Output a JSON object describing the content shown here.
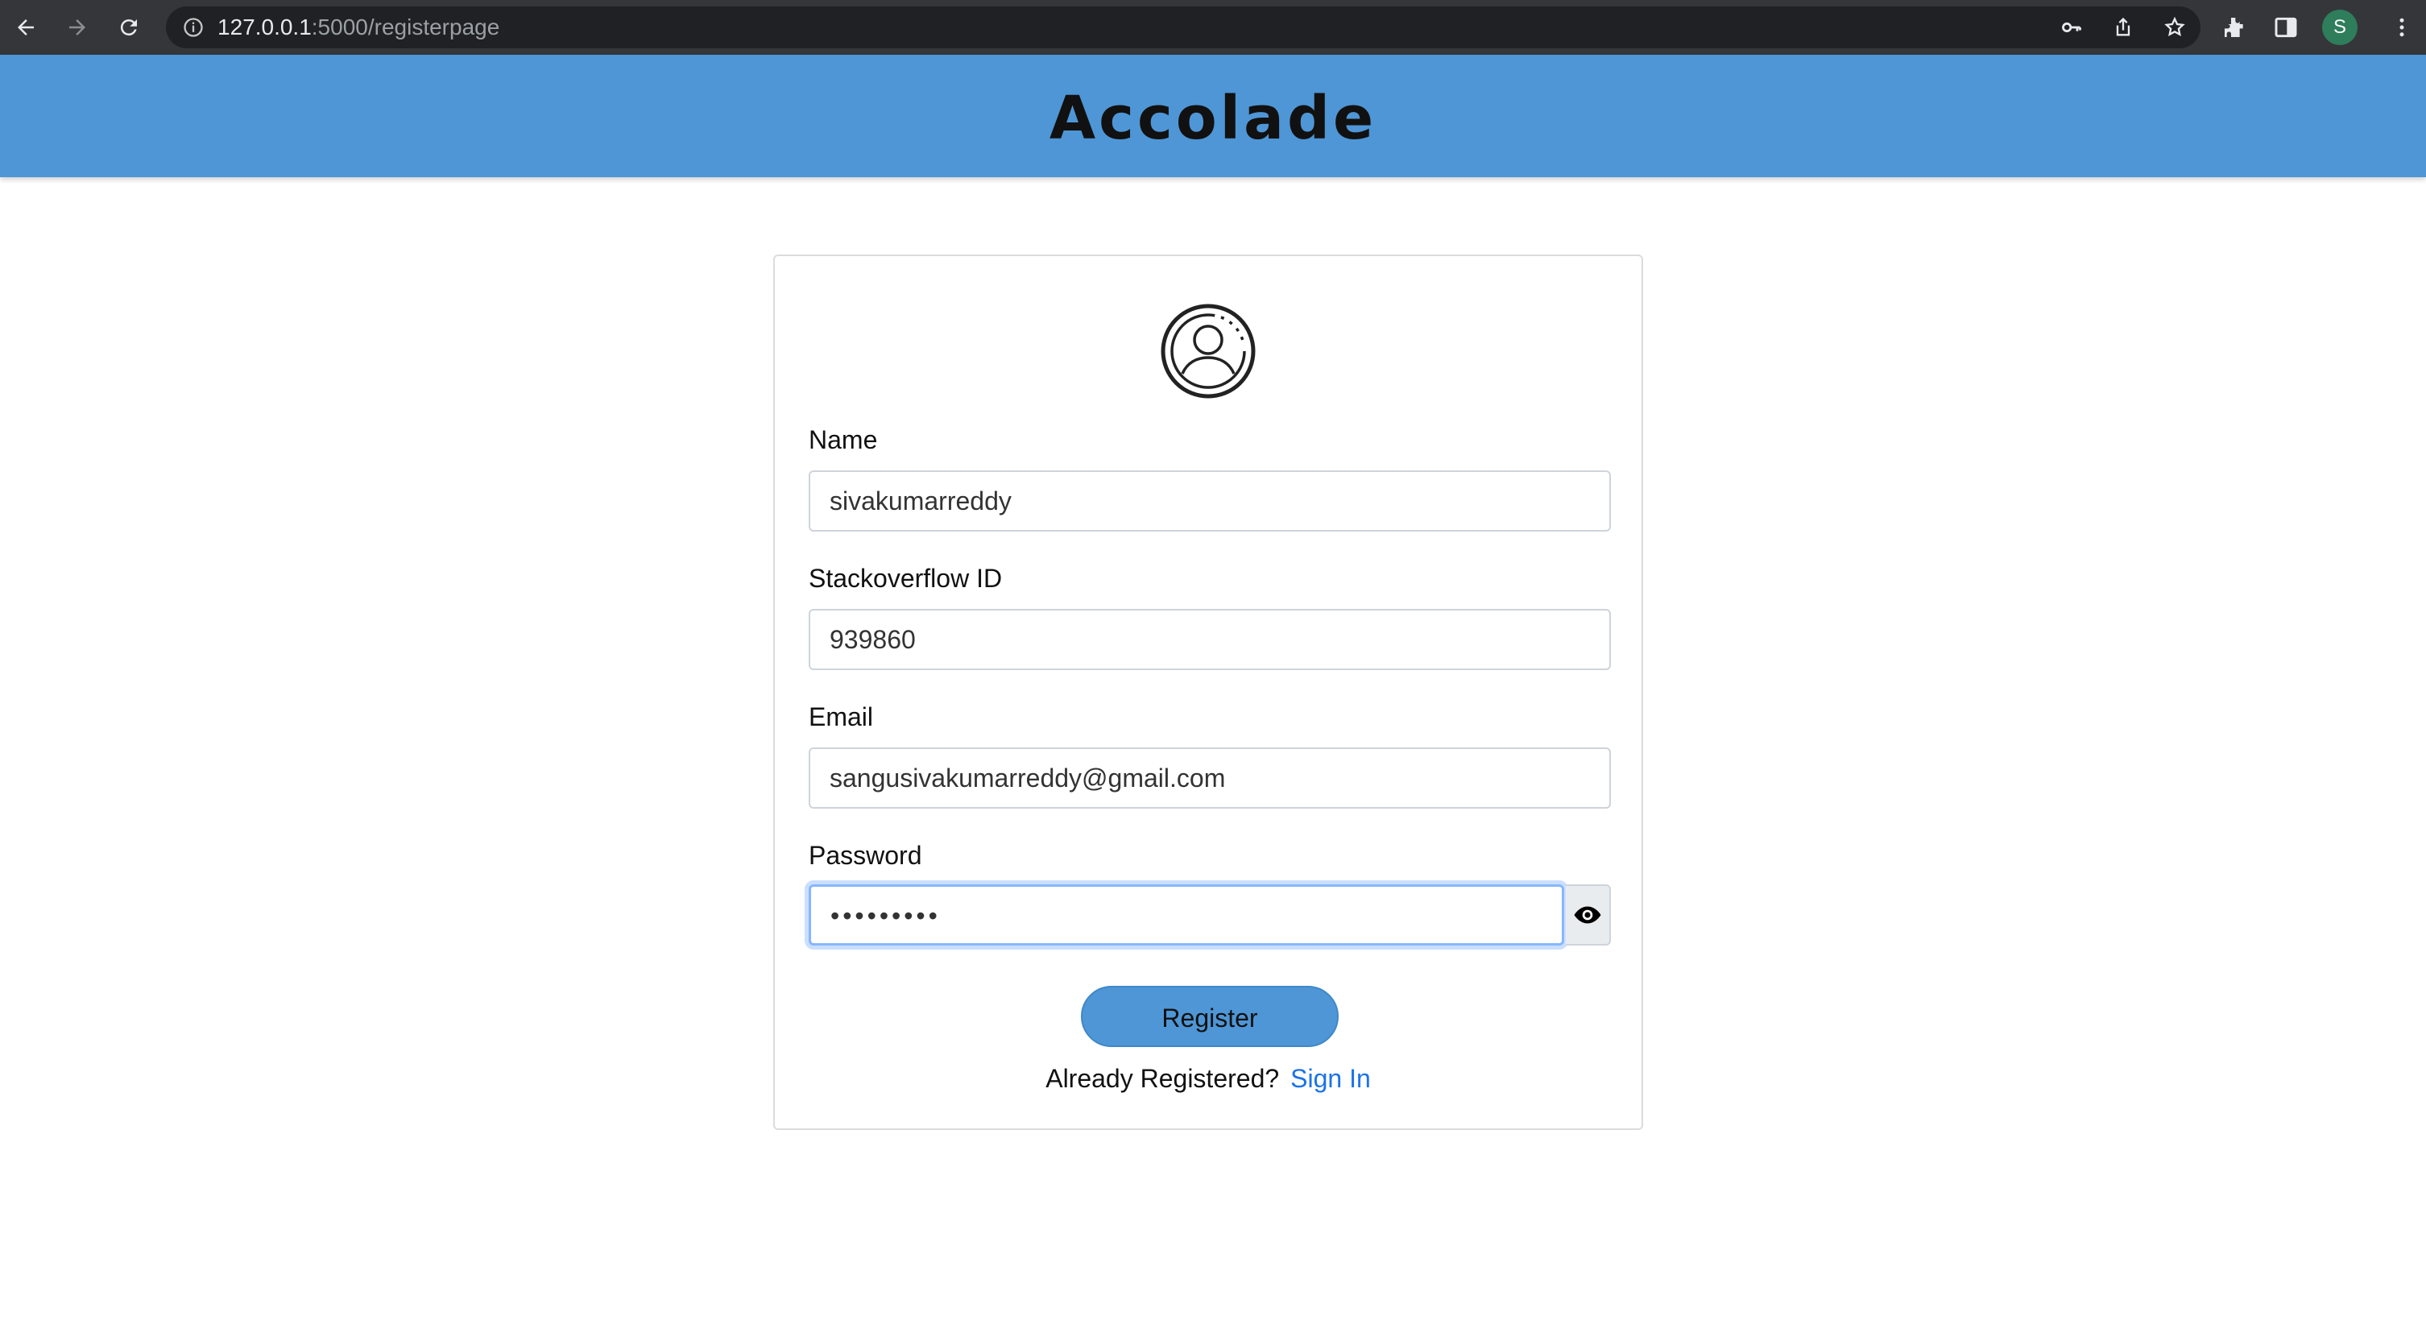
{
  "browser": {
    "url_host": "127.0.0.1",
    "url_path": ":5000/registerpage",
    "profile_initial": "S"
  },
  "app": {
    "brand": "Accolade"
  },
  "form": {
    "name_label": "Name",
    "name_value": "sivakumarreddy",
    "stackoverflow_label": "Stackoverflow ID",
    "stackoverflow_value": "939860",
    "email_label": "Email",
    "email_value": "sangusivakumarreddy@gmail.com",
    "password_label": "Password",
    "password_value": "•••••••••",
    "register_label": "Register",
    "already_text": "Already Registered?",
    "signin_label": "Sign In"
  },
  "colors": {
    "header_bg": "#4e96d6",
    "link": "#1a73e8"
  },
  "icons": {
    "avatar": "user-circle-icon",
    "password_toggle": "eye-icon"
  }
}
